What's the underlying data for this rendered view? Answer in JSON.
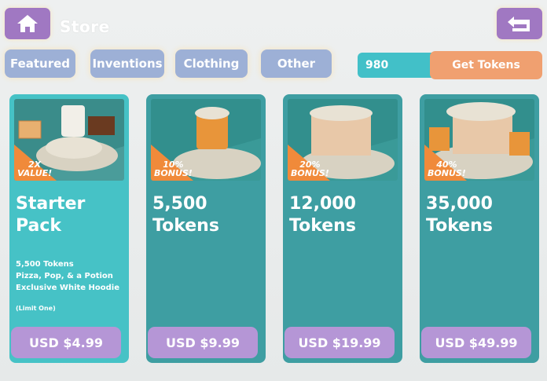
{
  "header": {
    "title": "Store",
    "home_icon": "home-icon",
    "back_icon": "back-arrow-icon"
  },
  "tabs": [
    {
      "label": "Featured"
    },
    {
      "label": "Inventions"
    },
    {
      "label": "Clothing"
    },
    {
      "label": "Other"
    }
  ],
  "tokens": {
    "balance": "980",
    "get_label": "Get Tokens"
  },
  "products": [
    {
      "title_line1": "Starter",
      "title_line2": "Pack",
      "badge_line1": "2X",
      "badge_line2": "VALUE!",
      "details": [
        "5,500 Tokens",
        "Pizza, Pop, & a Potion",
        "Exclusive White Hoodie"
      ],
      "limit": "(Limit One)",
      "price": "USD $4.99"
    },
    {
      "title_line1": "5,500",
      "title_line2": "Tokens",
      "badge_line1": "10%",
      "badge_line2": "BONUS!",
      "price": "USD $9.99"
    },
    {
      "title_line1": "12,000",
      "title_line2": "Tokens",
      "badge_line1": "20%",
      "badge_line2": "BONUS!",
      "price": "USD $19.99"
    },
    {
      "title_line1": "35,000",
      "title_line2": "Tokens",
      "badge_line1": "40%",
      "badge_line2": "BONUS!",
      "price": "USD $49.99"
    }
  ],
  "colors": {
    "purple": "#a078c2",
    "tab_blue": "#9db0d6",
    "teal": "#42c0c8",
    "card_teal": "#3e9ea2",
    "orange": "#f0a070",
    "price_purple": "#b596d6"
  }
}
